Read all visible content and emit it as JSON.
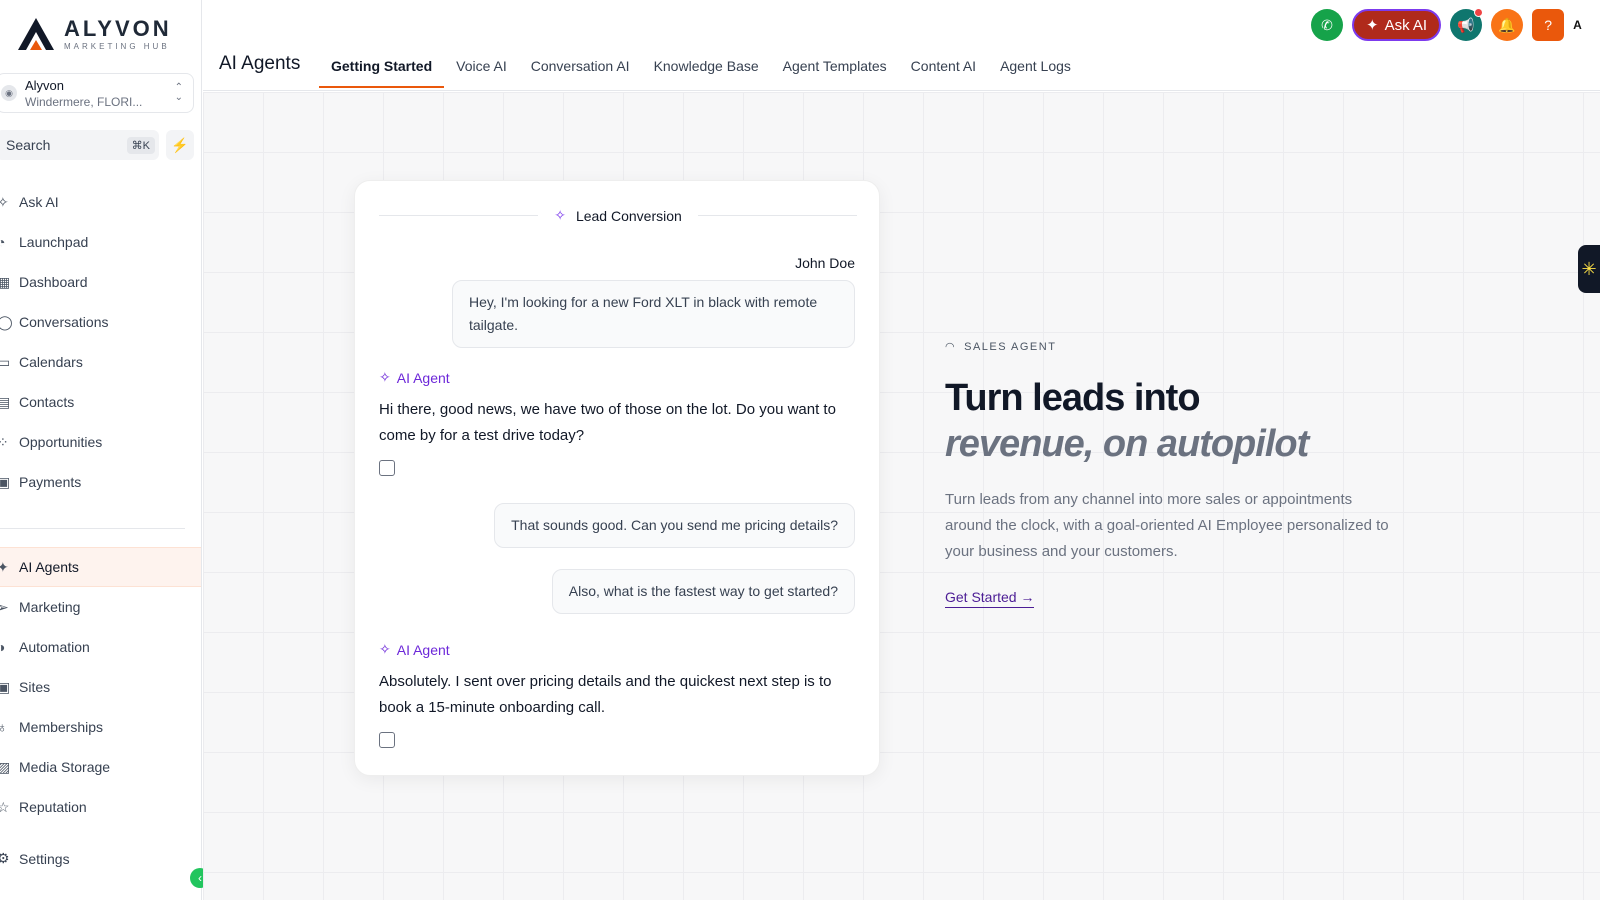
{
  "brand": {
    "name": "ALYVON",
    "subtitle": "MARKETING HUB"
  },
  "account": {
    "name": "Alyvon",
    "location": "Windermere, FLORI..."
  },
  "search": {
    "placeholder": "Search",
    "shortcut": "⌘K"
  },
  "sidebar": {
    "items": [
      {
        "label": "Ask AI",
        "icon": "sparkle-icon"
      },
      {
        "label": "Launchpad",
        "icon": "rocket-icon"
      },
      {
        "label": "Dashboard",
        "icon": "dashboard-icon"
      },
      {
        "label": "Conversations",
        "icon": "chat-icon"
      },
      {
        "label": "Calendars",
        "icon": "calendar-icon"
      },
      {
        "label": "Contacts",
        "icon": "contacts-icon"
      },
      {
        "label": "Opportunities",
        "icon": "opportunities-icon"
      },
      {
        "label": "Payments",
        "icon": "payments-icon"
      }
    ],
    "items2": [
      {
        "label": "AI Agents",
        "icon": "ai-agent-icon",
        "active": true
      },
      {
        "label": "Marketing",
        "icon": "send-icon"
      },
      {
        "label": "Automation",
        "icon": "automation-icon"
      },
      {
        "label": "Sites",
        "icon": "sites-icon"
      },
      {
        "label": "Memberships",
        "icon": "membership-icon"
      },
      {
        "label": "Media Storage",
        "icon": "media-icon"
      },
      {
        "label": "Reputation",
        "icon": "star-icon"
      }
    ],
    "settings": "Settings"
  },
  "header": {
    "title": "AI Agents",
    "tabs": [
      {
        "label": "Getting Started",
        "active": true
      },
      {
        "label": "Voice AI"
      },
      {
        "label": "Conversation AI"
      },
      {
        "label": "Knowledge Base"
      },
      {
        "label": "Agent Templates"
      },
      {
        "label": "Content AI"
      },
      {
        "label": "Agent Logs"
      }
    ],
    "ask_ai": "Ask AI",
    "help": "?"
  },
  "card": {
    "title": "Lead Conversion",
    "sender": "John Doe",
    "messages": {
      "user1": "Hey, I'm looking for a new Ford XLT in black with remote tailgate.",
      "agent_label": "AI Agent",
      "agent1": "Hi there, good news, we have two of those on the lot. Do you want to come by for a test drive today?",
      "user2": "That sounds good. Can you send me pricing details?",
      "user3": "Also, what is the fastest way to get started?",
      "agent2": "Absolutely. I sent over pricing details and the quickest next step is to book a 15-minute onboarding call."
    }
  },
  "hero": {
    "tag": "SALES AGENT",
    "heading1": "Turn leads into",
    "heading2": "revenue, on autopilot",
    "description": "Turn leads from any channel into more sales or appointments around the clock, with a goal-oriented AI Employee personalized to your business and your customers.",
    "cta": "Get Started →"
  },
  "colors": {
    "accent": "#ea580c",
    "agent": "#6d28d9",
    "phone": "#16a34a",
    "ask_ai": "#b02a1b"
  }
}
